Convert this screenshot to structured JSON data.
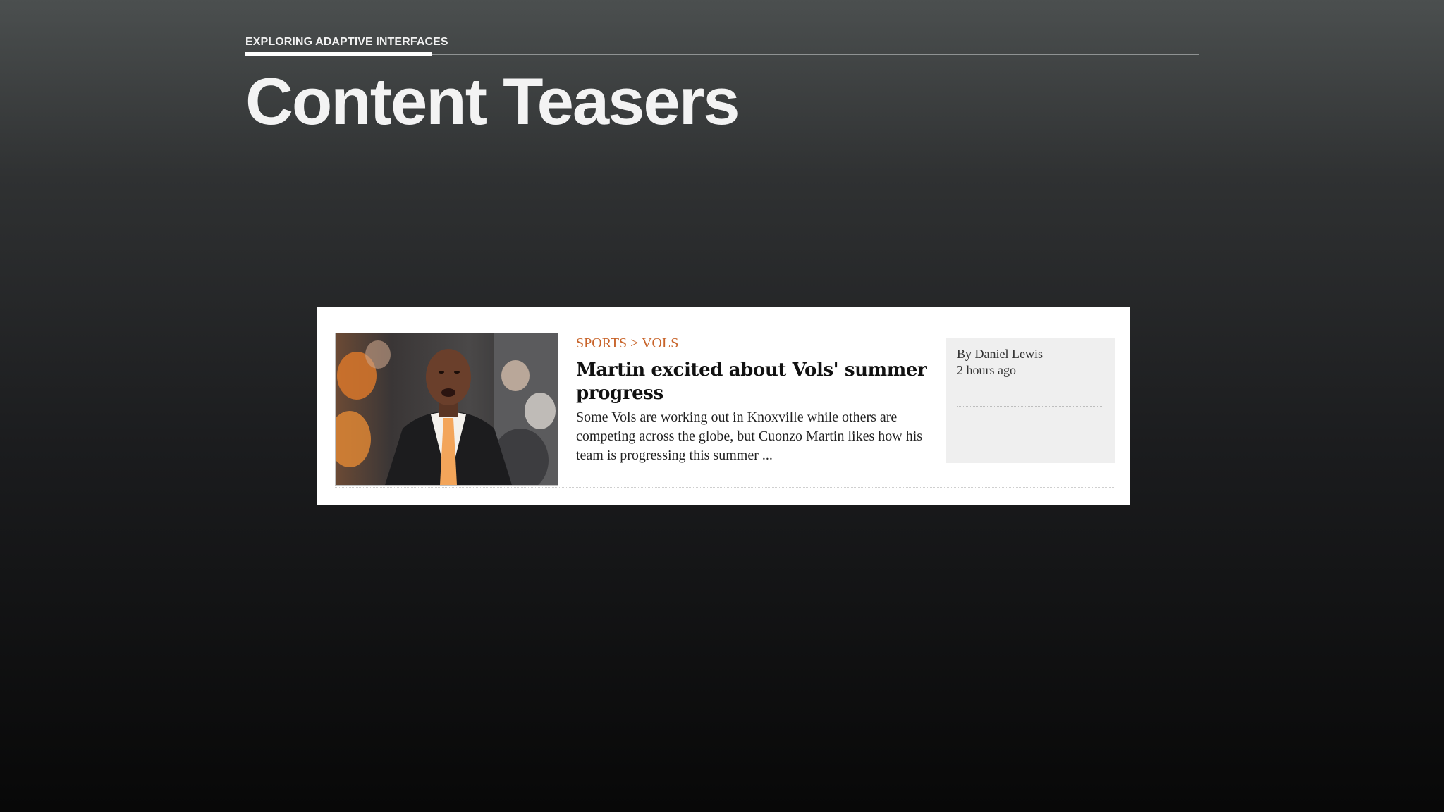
{
  "slide": {
    "eyebrow": "EXPLORING ADAPTIVE INTERFACES",
    "title": "Content Teasers"
  },
  "teaser": {
    "kicker_section": "SPORTS",
    "kicker_separator": ">",
    "kicker_subsection": "VOLS",
    "headline": "Martin excited about Vols' summer progress",
    "summary": "Some Vols are working out in Knoxville while others are competing across the globe, but Cuonzo Martin likes how his team is progressing this summer ...",
    "byline": "By Daniel Lewis",
    "timestamp": "2 hours ago",
    "image_icon": "photo-coach-icon"
  },
  "colors": {
    "accent": "#c8642a",
    "card_background": "#ffffff",
    "meta_background": "#efefef",
    "tie": "#f3a55a"
  }
}
